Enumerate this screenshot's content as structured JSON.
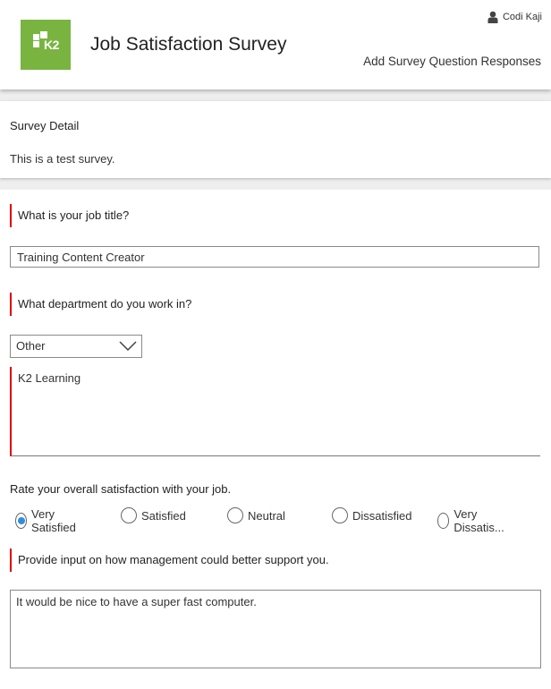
{
  "header": {
    "app_title": "Job Satisfaction Survey",
    "logo_text": "K2",
    "user_name": "Codi Kaji",
    "page_subtitle": "Add Survey Question Responses",
    "brand_color": "#79b441"
  },
  "survey_detail": {
    "heading": "Survey Detail",
    "description": "This is a test survey."
  },
  "questions": {
    "job_title": {
      "label": "What is your job title?",
      "value": "Training Content Creator"
    },
    "department": {
      "label": "What department do you work in?",
      "selected": "Other",
      "other_value": "K2 Learning"
    },
    "satisfaction": {
      "label": "Rate your overall satisfaction with your job.",
      "options": [
        "Very Satisfied",
        "Satisfied",
        "Neutral",
        "Dissatisfied",
        "Very Dissatis..."
      ],
      "selected_index": 0
    },
    "management": {
      "label": "Provide input on how management could better support you.",
      "value": "It would be nice to have a super fast computer."
    }
  },
  "colors": {
    "required_marker": "#e00000",
    "radio_selected": "#2f8ee0"
  }
}
